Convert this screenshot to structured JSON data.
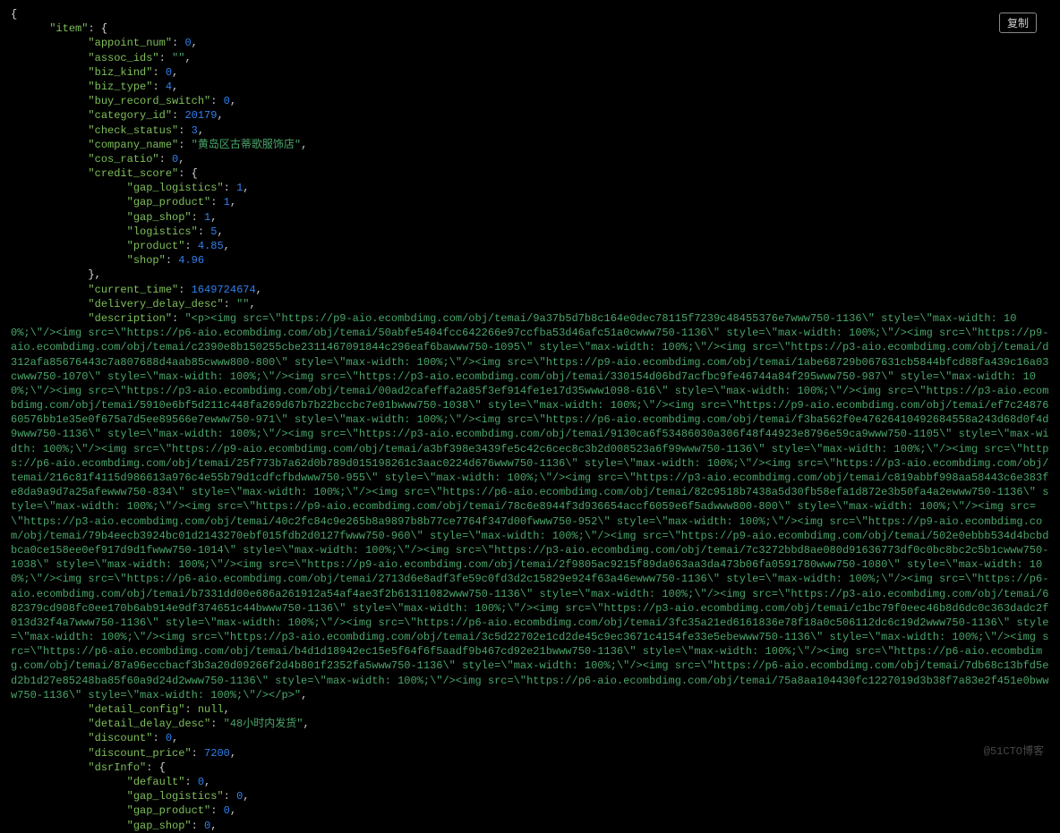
{
  "ui": {
    "copy_button_label": "复制",
    "watermark_text": "@51CTO博客"
  },
  "json": {
    "item": {
      "appoint_num": 0,
      "assoc_ids": "",
      "biz_kind": 0,
      "biz_type": 4,
      "buy_record_switch": 0,
      "category_id": 20179,
      "check_status": 3,
      "company_name": "黄岛区古蒂歌服饰店",
      "cos_ratio": 0,
      "credit_score": {
        "gap_logistics": 1,
        "gap_product": 1,
        "gap_shop": 1,
        "logistics": 5,
        "product": 4.85,
        "shop": 4.96
      },
      "current_time": 1649724674,
      "delivery_delay_desc": "",
      "description": "<p><img src=\\\"https://p9-aio.ecombdimg.com/obj/temai/9a37b5d7b8c164e0dec78115f7239c48455376e7www750-1136\\\" style=\\\"max-width: 100%;\\\"/><img src=\\\"https://p6-aio.ecombdimg.com/obj/temai/50abfe5404fcc642266e97ccfba53d46afc51a0cwww750-1136\\\" style=\\\"max-width: 100%;\\\"/><img src=\\\"https://p9-aio.ecombdimg.com/obj/temai/c2390e8b150255cbe2311467091844c296eaf6bawww750-1095\\\" style=\\\"max-width: 100%;\\\"/><img src=\\\"https://p3-aio.ecombdimg.com/obj/temai/d312afa85676443c7a807688d4aab85cwww800-800\\\" style=\\\"max-width: 100%;\\\"/><img src=\\\"https://p9-aio.ecombdimg.com/obj/temai/1abe68729b067631cb5844bfcd88fa439c16a03cwww750-1070\\\" style=\\\"max-width: 100%;\\\"/><img src=\\\"https://p3-aio.ecombdimg.com/obj/temai/330154d06bd7acfbc9fe46744a84f295www750-987\\\" style=\\\"max-width: 100%;\\\"/><img src=\\\"https://p3-aio.ecombdimg.com/obj/temai/00ad2cafeffa2a85f3ef914fe1e17d35www1098-616\\\" style=\\\"max-width: 100%;\\\"/><img src=\\\"https://p3-aio.ecombdimg.com/obj/temai/5910e6bf5d211c448fa269d67b7b22bccbc7e01bwww750-1038\\\" style=\\\"max-width: 100%;\\\"/><img src=\\\"https://p9-aio.ecombdimg.com/obj/temai/ef7c2487660576bb1e35e0f675a7d5ee89566e7ewww750-971\\\" style=\\\"max-width: 100%;\\\"/><img src=\\\"https://p6-aio.ecombdimg.com/obj/temai/f3ba562f0e47626410492684558a243d68d0f4d9www750-1136\\\" style=\\\"max-width: 100%;\\\"/><img src=\\\"https://p3-aio.ecombdimg.com/obj/temai/9130ca6f53486030a306f48f44923e8796e59ca9www750-1105\\\" style=\\\"max-width: 100%;\\\"/><img src=\\\"https://p9-aio.ecombdimg.com/obj/temai/a3bf398e3439fe5c42c6cec8c3b2d008523a6f99www750-1136\\\" style=\\\"max-width: 100%;\\\"/><img src=\\\"https://p6-aio.ecombdimg.com/obj/temai/25f773b7a62d0b789d015198261c3aac0224d676www750-1136\\\" style=\\\"max-width: 100%;\\\"/><img src=\\\"https://p3-aio.ecombdimg.com/obj/temai/216c81f4115d986613a976c4e55b79d1cdfcfbdwww750-955\\\" style=\\\"max-width: 100%;\\\"/><img src=\\\"https://p3-aio.ecombdimg.com/obj/temai/c819abbf998aa58443c6e383fe8da9a9d7a25afewww750-834\\\" style=\\\"max-width: 100%;\\\"/><img src=\\\"https://p6-aio.ecombdimg.com/obj/temai/82c9518b7438a5d30fb58efa1d872e3b50fa4a2ewww750-1136\\\" style=\\\"max-width: 100%;\\\"/><img src=\\\"https://p9-aio.ecombdimg.com/obj/temai/78c6e8944f3d936654accf6059e6f5adwww800-800\\\" style=\\\"max-width: 100%;\\\"/><img src=\\\"https://p3-aio.ecombdimg.com/obj/temai/40c2fc84c9e265b8a9897b8b77ce7764f347d00fwww750-952\\\" style=\\\"max-width: 100%;\\\"/><img src=\\\"https://p9-aio.ecombdimg.com/obj/temai/79b4eecb3924bc01d2143270ebf015fdb2d0127fwww750-960\\\" style=\\\"max-width: 100%;\\\"/><img src=\\\"https://p9-aio.ecombdimg.com/obj/temai/502e0ebbb534d4bcbdbca0ce158ee0ef917d9d1fwww750-1014\\\" style=\\\"max-width: 100%;\\\"/><img src=\\\"https://p3-aio.ecombdimg.com/obj/temai/7c3272bbd8ae080d91636773df0c0bc8bc2c5b1cwww750-1038\\\" style=\\\"max-width: 100%;\\\"/><img src=\\\"https://p9-aio.ecombdimg.com/obj/temai/2f9805ac9215f89da063aa3da473b06fa0591780www750-1080\\\" style=\\\"max-width: 100%;\\\"/><img src=\\\"https://p6-aio.ecombdimg.com/obj/temai/2713d6e8adf3fe59c0fd3d2c15829e924f63a46ewww750-1136\\\" style=\\\"max-width: 100%;\\\"/><img src=\\\"https://p6-aio.ecombdimg.com/obj/temai/b7331dd00e686a261912a54af4ae3f2b61311082www750-1136\\\" style=\\\"max-width: 100%;\\\"/><img src=\\\"https://p3-aio.ecombdimg.com/obj/temai/682379cd908fc0ee170b6ab914e9df374651c44bwww750-1136\\\" style=\\\"max-width: 100%;\\\"/><img src=\\\"https://p3-aio.ecombdimg.com/obj/temai/c1bc79f0eec46b8d6dc0c363dadc2f013d32f4a7www750-1136\\\" style=\\\"max-width: 100%;\\\"/><img src=\\\"https://p6-aio.ecombdimg.com/obj/temai/3fc35a21ed6161836e78f18a0c506112dc6c19d2www750-1136\\\" style=\\\"max-width: 100%;\\\"/><img src=\\\"https://p3-aio.ecombdimg.com/obj/temai/3c5d22702e1cd2de45c9ec3671c4154fe33e5ebewww750-1136\\\" style=\\\"max-width: 100%;\\\"/><img src=\\\"https://p6-aio.ecombdimg.com/obj/temai/b4d1d18942ec15e5f64f6f5aadf9b467cd92e21bwww750-1136\\\" style=\\\"max-width: 100%;\\\"/><img src=\\\"https://p6-aio.ecombdimg.com/obj/temai/87a96eccbacf3b3a20d09266f2d4b801f2352fa5www750-1136\\\" style=\\\"max-width: 100%;\\\"/><img src=\\\"https://p6-aio.ecombdimg.com/obj/temai/7db68c13bfd5ed2b1d27e85248ba85f60a9d24d2www750-1136\\\" style=\\\"max-width: 100%;\\\"/><img src=\\\"https://p6-aio.ecombdimg.com/obj/temai/75a8aa104430fc1227019d3b38f7a83e2f451e0bwww750-1136\\\" style=\\\"max-width: 100%;\\\"/></p>",
      "detail_config": null,
      "detail_delay_desc": "48小时内发货",
      "discount": 0,
      "discount_price": 7200,
      "dsrInfo": {
        "default": 0,
        "gap_logistics": 0,
        "gap_product": 0,
        "gap_shop": 0
      }
    }
  },
  "rendered_lines": [
    [
      [
        "w",
        "{"
      ]
    ],
    [
      [
        "w",
        "      "
      ],
      [
        "k",
        "\"item\""
      ],
      [
        "p",
        ": "
      ],
      [
        "w",
        "{"
      ]
    ],
    [
      [
        "w",
        "            "
      ],
      [
        "k",
        "\"appoint_num\""
      ],
      [
        "p",
        ": "
      ],
      [
        "n",
        "0"
      ],
      [
        "p",
        ","
      ]
    ],
    [
      [
        "w",
        "            "
      ],
      [
        "k",
        "\"assoc_ids\""
      ],
      [
        "p",
        ": "
      ],
      [
        "s",
        "\"\""
      ],
      [
        "p",
        ","
      ]
    ],
    [
      [
        "w",
        "            "
      ],
      [
        "k",
        "\"biz_kind\""
      ],
      [
        "p",
        ": "
      ],
      [
        "n",
        "0"
      ],
      [
        "p",
        ","
      ]
    ],
    [
      [
        "w",
        "            "
      ],
      [
        "k",
        "\"biz_type\""
      ],
      [
        "p",
        ": "
      ],
      [
        "n",
        "4"
      ],
      [
        "p",
        ","
      ]
    ],
    [
      [
        "w",
        "            "
      ],
      [
        "k",
        "\"buy_record_switch\""
      ],
      [
        "p",
        ": "
      ],
      [
        "n",
        "0"
      ],
      [
        "p",
        ","
      ]
    ],
    [
      [
        "w",
        "            "
      ],
      [
        "k",
        "\"category_id\""
      ],
      [
        "p",
        ": "
      ],
      [
        "n",
        "20179"
      ],
      [
        "p",
        ","
      ]
    ],
    [
      [
        "w",
        "            "
      ],
      [
        "k",
        "\"check_status\""
      ],
      [
        "p",
        ": "
      ],
      [
        "n",
        "3"
      ],
      [
        "p",
        ","
      ]
    ],
    [
      [
        "w",
        "            "
      ],
      [
        "k",
        "\"company_name\""
      ],
      [
        "p",
        ": "
      ],
      [
        "s",
        "\"黄岛区古蒂歌服饰店\""
      ],
      [
        "p",
        ","
      ]
    ],
    [
      [
        "w",
        "            "
      ],
      [
        "k",
        "\"cos_ratio\""
      ],
      [
        "p",
        ": "
      ],
      [
        "n",
        "0"
      ],
      [
        "p",
        ","
      ]
    ],
    [
      [
        "w",
        "            "
      ],
      [
        "k",
        "\"credit_score\""
      ],
      [
        "p",
        ": "
      ],
      [
        "w",
        "{"
      ]
    ],
    [
      [
        "w",
        "                  "
      ],
      [
        "k",
        "\"gap_logistics\""
      ],
      [
        "p",
        ": "
      ],
      [
        "n",
        "1"
      ],
      [
        "p",
        ","
      ]
    ],
    [
      [
        "w",
        "                  "
      ],
      [
        "k",
        "\"gap_product\""
      ],
      [
        "p",
        ": "
      ],
      [
        "n",
        "1"
      ],
      [
        "p",
        ","
      ]
    ],
    [
      [
        "w",
        "                  "
      ],
      [
        "k",
        "\"gap_shop\""
      ],
      [
        "p",
        ": "
      ],
      [
        "n",
        "1"
      ],
      [
        "p",
        ","
      ]
    ],
    [
      [
        "w",
        "                  "
      ],
      [
        "k",
        "\"logistics\""
      ],
      [
        "p",
        ": "
      ],
      [
        "n",
        "5"
      ],
      [
        "p",
        ","
      ]
    ],
    [
      [
        "w",
        "                  "
      ],
      [
        "k",
        "\"product\""
      ],
      [
        "p",
        ": "
      ],
      [
        "n",
        "4.85"
      ],
      [
        "p",
        ","
      ]
    ],
    [
      [
        "w",
        "                  "
      ],
      [
        "k",
        "\"shop\""
      ],
      [
        "p",
        ": "
      ],
      [
        "n",
        "4.96"
      ]
    ],
    [
      [
        "w",
        "            },"
      ]
    ],
    [
      [
        "w",
        "            "
      ],
      [
        "k",
        "\"current_time\""
      ],
      [
        "p",
        ": "
      ],
      [
        "n",
        "1649724674"
      ],
      [
        "p",
        ","
      ]
    ],
    [
      [
        "w",
        "            "
      ],
      [
        "k",
        "\"delivery_delay_desc\""
      ],
      [
        "p",
        ": "
      ],
      [
        "s",
        "\"\""
      ],
      [
        "p",
        ","
      ]
    ],
    "__DESC__",
    [
      [
        "w",
        "            "
      ],
      [
        "k",
        "\"detail_config\""
      ],
      [
        "p",
        ": "
      ],
      [
        "nl",
        "null"
      ],
      [
        "p",
        ","
      ]
    ],
    [
      [
        "w",
        "            "
      ],
      [
        "k",
        "\"detail_delay_desc\""
      ],
      [
        "p",
        ": "
      ],
      [
        "s",
        "\"48小时内发货\""
      ],
      [
        "p",
        ","
      ]
    ],
    [
      [
        "w",
        "            "
      ],
      [
        "k",
        "\"discount\""
      ],
      [
        "p",
        ": "
      ],
      [
        "n",
        "0"
      ],
      [
        "p",
        ","
      ]
    ],
    [
      [
        "w",
        "            "
      ],
      [
        "k",
        "\"discount_price\""
      ],
      [
        "p",
        ": "
      ],
      [
        "n",
        "7200"
      ],
      [
        "p",
        ","
      ]
    ],
    [
      [
        "w",
        "            "
      ],
      [
        "k",
        "\"dsrInfo\""
      ],
      [
        "p",
        ": "
      ],
      [
        "w",
        "{"
      ]
    ],
    [
      [
        "w",
        "                  "
      ],
      [
        "k",
        "\"default\""
      ],
      [
        "p",
        ": "
      ],
      [
        "n",
        "0"
      ],
      [
        "p",
        ","
      ]
    ],
    [
      [
        "w",
        "                  "
      ],
      [
        "k",
        "\"gap_logistics\""
      ],
      [
        "p",
        ": "
      ],
      [
        "n",
        "0"
      ],
      [
        "p",
        ","
      ]
    ],
    [
      [
        "w",
        "                  "
      ],
      [
        "k",
        "\"gap_product\""
      ],
      [
        "p",
        ": "
      ],
      [
        "n",
        "0"
      ],
      [
        "p",
        ","
      ]
    ],
    [
      [
        "w",
        "                  "
      ],
      [
        "k",
        "\"gap_shop\""
      ],
      [
        "p",
        ": "
      ],
      [
        "n",
        "0"
      ],
      [
        "p",
        ","
      ]
    ]
  ]
}
